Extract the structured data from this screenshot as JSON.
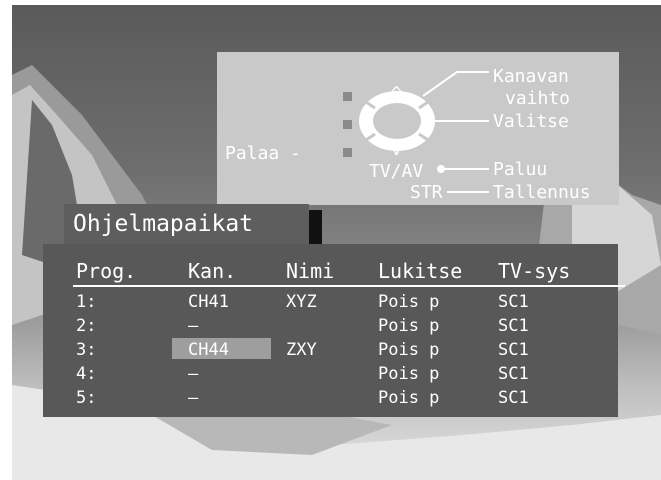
{
  "help": {
    "channel_change_1": "Kanavan",
    "channel_change_2": "vaihto",
    "select": "Valitse",
    "back": "Palaa -",
    "tv_av": "TV/AV",
    "return": "Paluu",
    "str": "STR",
    "save": "Tallennus",
    "up_symbol": "^",
    "down_symbol": "v",
    "minus_symbol": "−",
    "plus_symbol": "+"
  },
  "title": "Ohjelmapaikat",
  "table": {
    "headers": [
      "Prog.",
      "Kan.",
      "Nimi",
      "Lukitse",
      "TV-sys"
    ],
    "rows": [
      [
        "1:",
        "CH41",
        "XYZ",
        "Pois p",
        "SC1"
      ],
      [
        "2:",
        "–",
        "",
        "Pois p",
        "SC1"
      ],
      [
        "3:",
        "CH44",
        "ZXY",
        "Pois p",
        "SC1"
      ],
      [
        "4:",
        "–",
        "",
        "Pois p",
        "SC1"
      ],
      [
        "5:",
        "–",
        "",
        "Pois p",
        "SC1"
      ]
    ],
    "selected_row": 3,
    "selected_column": "Kan."
  }
}
